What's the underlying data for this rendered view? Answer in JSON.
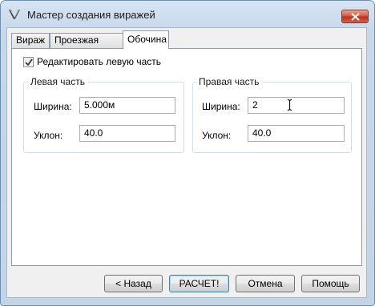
{
  "window": {
    "title": "Мастер создания виражей"
  },
  "tabs": [
    {
      "label": "Вираж"
    },
    {
      "label": "Проезжая часть"
    },
    {
      "label": "Обочина"
    }
  ],
  "edit_left": {
    "label": "Редактировать левую часть",
    "checked": true
  },
  "left_group": {
    "title": "Левая часть",
    "width_label": "Ширина:",
    "width_value": "5.000м",
    "slope_label": "Уклон:",
    "slope_value": "40.0"
  },
  "right_group": {
    "title": "Правая часть",
    "width_label": "Ширина:",
    "width_value": "2",
    "slope_label": "Уклон:",
    "slope_value": "40.0"
  },
  "buttons": {
    "back": "< Назад",
    "calculate": "РАСЧЕТ!",
    "cancel": "Отмена",
    "help": "Помощь"
  }
}
